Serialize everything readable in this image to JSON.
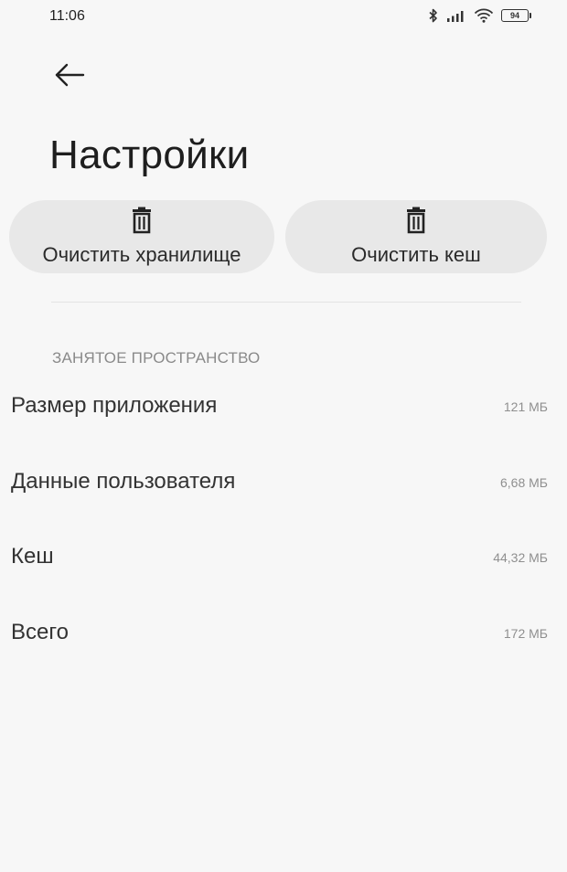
{
  "status_bar": {
    "time": "11:06",
    "battery": "94",
    "icons": [
      "bluetooth-icon",
      "signal-icon",
      "wifi-icon",
      "battery-icon"
    ]
  },
  "header": {
    "back_icon": "back-arrow-icon",
    "title": "Настройки"
  },
  "actions": [
    {
      "label": "Очистить хранилище",
      "icon": "trash-icon"
    },
    {
      "label": "Очистить кеш",
      "icon": "trash-icon"
    }
  ],
  "storage": {
    "section_title": "ЗАНЯТОЕ ПРОСТРАНСТВО",
    "rows": [
      {
        "label": "Размер приложения",
        "value": "121 МБ"
      },
      {
        "label": "Данные пользователя",
        "value": "6,68 МБ"
      },
      {
        "label": "Кеш",
        "value": "44,32 МБ"
      },
      {
        "label": "Всего",
        "value": "172 МБ"
      }
    ]
  },
  "colors": {
    "background": "#f7f7f7",
    "button_background": "#e8e8e8",
    "text_primary": "#222222",
    "text_secondary": "#8a8a8a"
  }
}
